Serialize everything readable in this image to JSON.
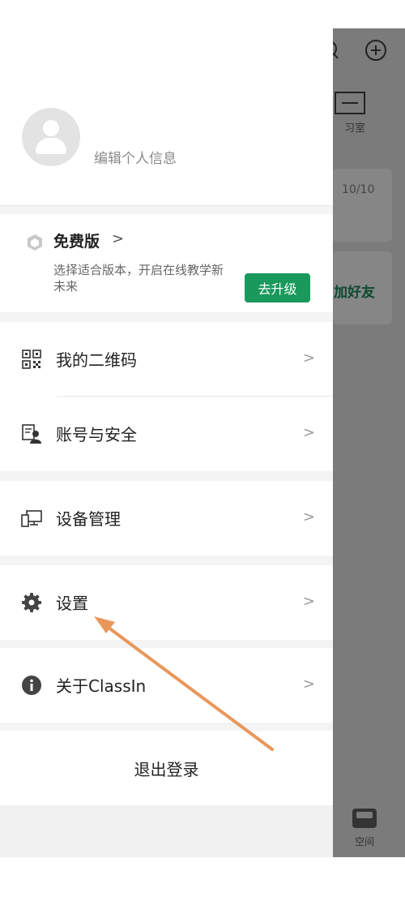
{
  "background": {
    "stat_count": "10/10",
    "tool_label": "习室",
    "add_friend": "加好友",
    "bottom_tab": "空间"
  },
  "profile": {
    "edit_label": "编辑个人信息"
  },
  "plan": {
    "title": "免费版",
    "chevron": ">",
    "description": "选择适合版本，开启在线教学新未来",
    "upgrade_button": "去升级"
  },
  "menu": {
    "qr_code": "我的二维码",
    "account_security": "账号与安全",
    "device_manage": "设备管理",
    "settings": "设置",
    "about": "关于ClassIn",
    "chevron": ">"
  },
  "logout_label": "退出登录",
  "colors": {
    "accent": "#19995c",
    "annotation_arrow": "#e8975a",
    "overlay": "#7b7b7b"
  }
}
